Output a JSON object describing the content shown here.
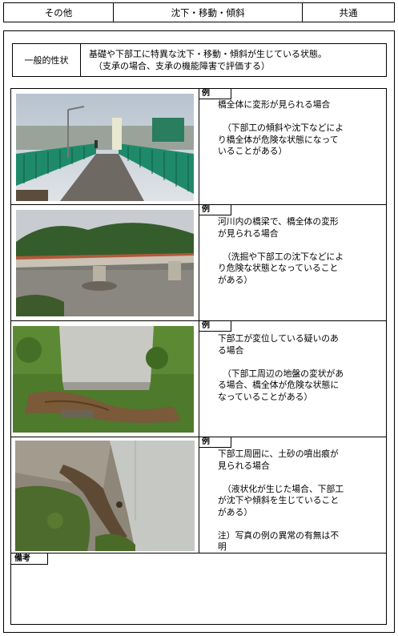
{
  "header": {
    "category": "その他",
    "title": "沈下・移動・傾斜",
    "scope": "共通"
  },
  "general": {
    "label": "一般的性状",
    "line1": "基礎や下部工に特異な沈下・移動・傾斜が生じている状態。",
    "line2": "（支承の場合、支承の機能障害で評価する）"
  },
  "examples": [
    {
      "tag": "例",
      "lines": [
        "橋全体に変形が見られる場合"
      ],
      "note": [
        "（下部工の傾斜や沈下などによ",
        "り橋全体が危険な状態になって",
        "いることがある）"
      ]
    },
    {
      "tag": "例",
      "lines": [
        "河川内の橋梁で、橋全体の変形",
        "が見られる場合"
      ],
      "note": [
        "（洗掘や下部工の沈下などによ",
        "り危険な状態となっていること",
        "がある）"
      ]
    },
    {
      "tag": "例",
      "lines": [
        "下部工が変位している疑いのあ",
        "る場合"
      ],
      "note": [
        "（下部工周辺の地盤の変状があ",
        "る場合、橋全体が危険な状態に",
        "なっていることがある）"
      ]
    },
    {
      "tag": "例",
      "lines": [
        "下部工周囲に、土砂の噴出痕が",
        "見られる場合"
      ],
      "note": [
        "（液状化が生じた場合、下部工",
        "が沈下や傾斜を生じていること",
        "がある）"
      ],
      "footnote": [
        "注）写真の例の異常の有無は不",
        "明"
      ]
    }
  ],
  "remarks": {
    "label": "備考"
  }
}
